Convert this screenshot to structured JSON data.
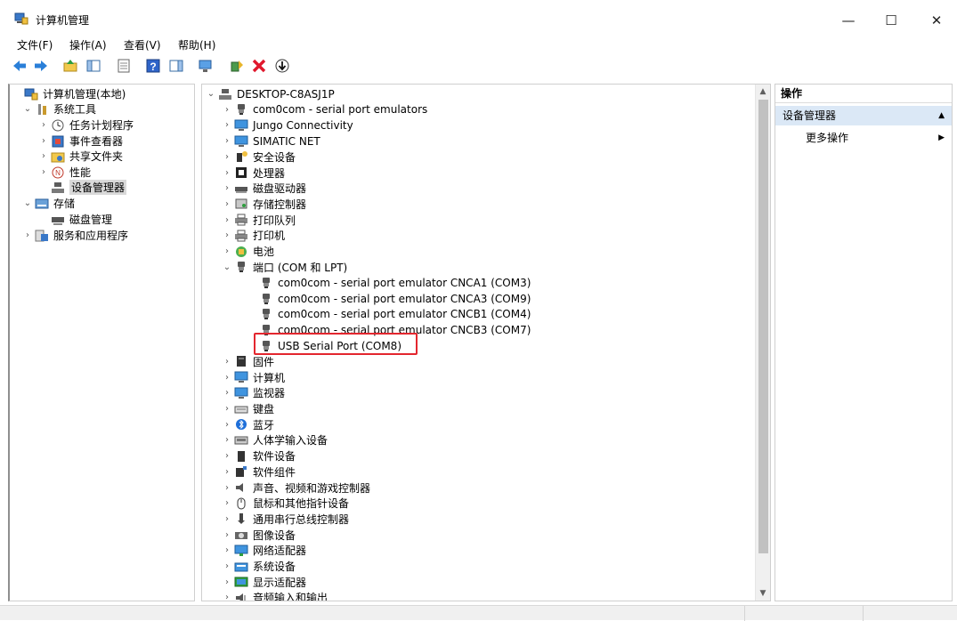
{
  "window": {
    "title": "计算机管理",
    "controls": {
      "minimize": "—",
      "maximize": "☐",
      "close": "✕"
    }
  },
  "menu": [
    "文件(F)",
    "操作(A)",
    "查看(V)",
    "帮助(H)"
  ],
  "left_tree": [
    {
      "label": "计算机管理(本地)",
      "icon": "computer-management-icon",
      "expander": "",
      "indent": 0
    },
    {
      "label": "系统工具",
      "icon": "system-tools-icon",
      "expander": "⌄",
      "indent": 1
    },
    {
      "label": "任务计划程序",
      "icon": "task-scheduler-icon",
      "expander": "›",
      "indent": 2
    },
    {
      "label": "事件查看器",
      "icon": "event-viewer-icon",
      "expander": "›",
      "indent": 2
    },
    {
      "label": "共享文件夹",
      "icon": "shared-folders-icon",
      "expander": "›",
      "indent": 2
    },
    {
      "label": "性能",
      "icon": "performance-icon",
      "expander": "›",
      "indent": 2
    },
    {
      "label": "设备管理器",
      "icon": "device-manager-icon",
      "expander": "",
      "indent": 2,
      "selected": true
    },
    {
      "label": "存储",
      "icon": "storage-icon",
      "expander": "⌄",
      "indent": 1
    },
    {
      "label": "磁盘管理",
      "icon": "disk-management-icon",
      "expander": "",
      "indent": 2
    },
    {
      "label": "服务和应用程序",
      "icon": "services-apps-icon",
      "expander": "›",
      "indent": 1
    }
  ],
  "device_tree": [
    {
      "label": "DESKTOP-C8ASJ1P",
      "icon": "computer-tree-icon",
      "expander": "⌄",
      "indent": 0
    },
    {
      "label": "com0com - serial port emulators",
      "icon": "serial-port-icon",
      "expander": "›",
      "indent": 1
    },
    {
      "label": "Jungo Connectivity",
      "icon": "monitor-icon",
      "expander": "›",
      "indent": 1
    },
    {
      "label": "SIMATIC NET",
      "icon": "monitor-icon",
      "expander": "›",
      "indent": 1
    },
    {
      "label": "安全设备",
      "icon": "security-device-icon",
      "expander": "›",
      "indent": 1
    },
    {
      "label": "处理器",
      "icon": "processor-icon",
      "expander": "›",
      "indent": 1
    },
    {
      "label": "磁盘驱动器",
      "icon": "disk-drive-icon",
      "expander": "›",
      "indent": 1
    },
    {
      "label": "存储控制器",
      "icon": "storage-controller-icon",
      "expander": "›",
      "indent": 1
    },
    {
      "label": "打印队列",
      "icon": "printer-icon",
      "expander": "›",
      "indent": 1
    },
    {
      "label": "打印机",
      "icon": "printer-icon",
      "expander": "›",
      "indent": 1
    },
    {
      "label": "电池",
      "icon": "battery-icon",
      "expander": "›",
      "indent": 1
    },
    {
      "label": "端口 (COM 和 LPT)",
      "icon": "serial-port-icon",
      "expander": "⌄",
      "indent": 1
    },
    {
      "label": "com0com - serial port emulator CNCA1 (COM3)",
      "icon": "serial-port-icon",
      "expander": "",
      "indent": 2
    },
    {
      "label": "com0com - serial port emulator CNCA3 (COM9)",
      "icon": "serial-port-icon",
      "expander": "",
      "indent": 2
    },
    {
      "label": "com0com - serial port emulator CNCB1 (COM4)",
      "icon": "serial-port-icon",
      "expander": "",
      "indent": 2
    },
    {
      "label": "com0com - serial port emulator CNCB3 (COM7)",
      "icon": "serial-port-icon",
      "expander": "",
      "indent": 2
    },
    {
      "label": "USB Serial Port (COM8)",
      "icon": "serial-port-icon",
      "expander": "",
      "indent": 2,
      "highlighted": true
    },
    {
      "label": "固件",
      "icon": "firmware-icon",
      "expander": "›",
      "indent": 1
    },
    {
      "label": "计算机",
      "icon": "monitor-icon",
      "expander": "›",
      "indent": 1
    },
    {
      "label": "监视器",
      "icon": "monitor-icon",
      "expander": "›",
      "indent": 1
    },
    {
      "label": "键盘",
      "icon": "keyboard-icon",
      "expander": "›",
      "indent": 1
    },
    {
      "label": "蓝牙",
      "icon": "bluetooth-icon",
      "expander": "›",
      "indent": 1
    },
    {
      "label": "人体学输入设备",
      "icon": "hid-icon",
      "expander": "›",
      "indent": 1
    },
    {
      "label": "软件设备",
      "icon": "software-device-icon",
      "expander": "›",
      "indent": 1
    },
    {
      "label": "软件组件",
      "icon": "software-component-icon",
      "expander": "›",
      "indent": 1
    },
    {
      "label": "声音、视频和游戏控制器",
      "icon": "sound-icon",
      "expander": "›",
      "indent": 1
    },
    {
      "label": "鼠标和其他指针设备",
      "icon": "mouse-icon",
      "expander": "›",
      "indent": 1
    },
    {
      "label": "通用串行总线控制器",
      "icon": "usb-icon",
      "expander": "›",
      "indent": 1
    },
    {
      "label": "图像设备",
      "icon": "imaging-icon",
      "expander": "›",
      "indent": 1
    },
    {
      "label": "网络适配器",
      "icon": "network-adapter-icon",
      "expander": "›",
      "indent": 1
    },
    {
      "label": "系统设备",
      "icon": "system-device-icon",
      "expander": "›",
      "indent": 1
    },
    {
      "label": "显示适配器",
      "icon": "display-adapter-icon",
      "expander": "›",
      "indent": 1
    },
    {
      "label": "音频输入和输出",
      "icon": "audio-io-icon",
      "expander": "›",
      "indent": 1
    }
  ],
  "actions": {
    "header": "操作",
    "section": "设备管理器",
    "section_arrow": "▲",
    "item": "更多操作",
    "item_arrow": "▶"
  },
  "colors": {
    "highlight_border": "#e3262e",
    "selection_bg": "#d9d9d9",
    "actions_section_bg": "#dbe8f6"
  }
}
